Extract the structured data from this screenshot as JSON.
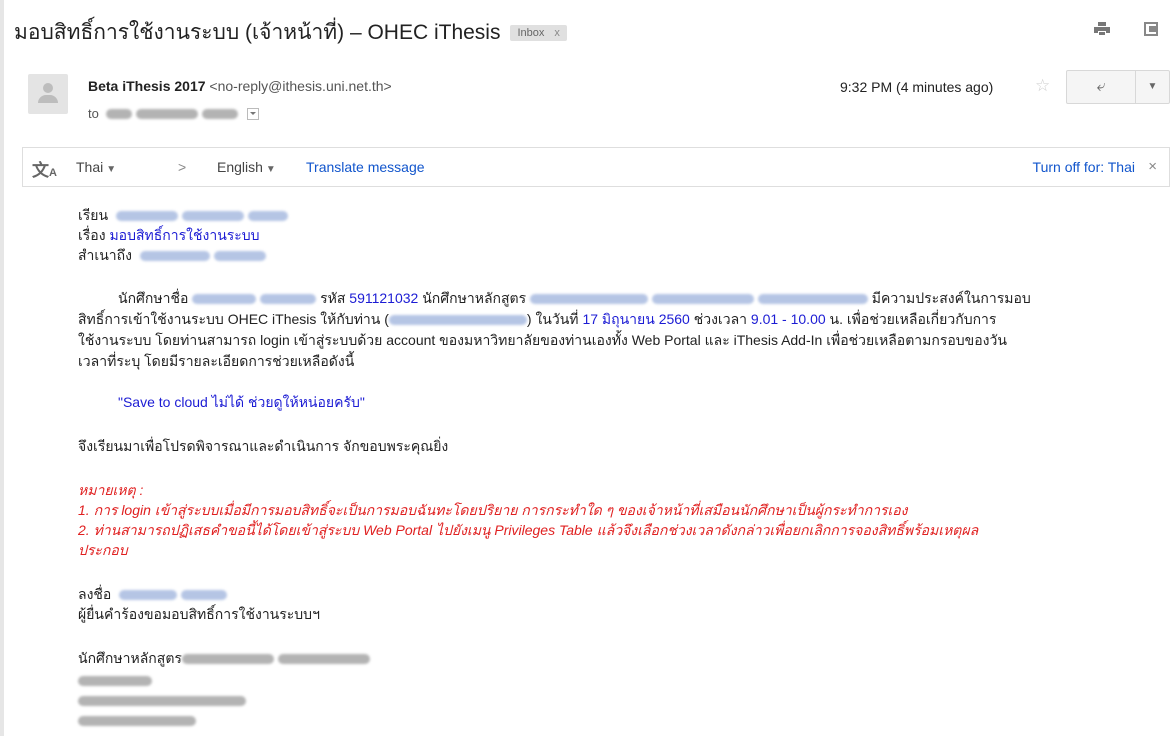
{
  "email": {
    "subject": "มอบสิทธิ์การใช้งานระบบ (เจ้าหน้าที่) – OHEC iThesis",
    "label_chip": "Inbox",
    "label_chip_close": "x",
    "sender_name": "Beta iThesis 2017",
    "sender_email": "<no-reply@ithesis.uni.net.th>",
    "to_prefix": "to",
    "timestamp": "9:32 PM (4 minutes ago)"
  },
  "translate": {
    "from_lang": "Thai",
    "arrow": ">",
    "to_lang": "English",
    "translate_link": "Translate message",
    "turn_off": "Turn off for: Thai",
    "close": "×"
  },
  "body": {
    "greeting_label": "เรียน",
    "subject_label": "เรื่อง",
    "subject_value": "มอบสิทธิ์การใช้งานระบบ",
    "cc_label": "สำเนาถึง",
    "p1_a": "นักศึกษาชื่อ",
    "p1_b": "รหัส",
    "student_id": "591121032",
    "p1_c": "นักศึกษาหลักสูตร",
    "p1_d": "มีความประสงค์ในการมอบ",
    "p2_a": "สิทธิ์การเข้าใช้งานระบบ OHEC iThesis ให้กับท่าน (",
    "p2_b": ") ในวันที่",
    "date_value": "17 มิถุนายน 2560",
    "p2_c": "ช่วงเวลา",
    "time_value": "9.01 - 10.00",
    "p2_d": "น. เพื่อช่วยเหลือเกี่ยวกับการ",
    "p3": "ใช้งานระบบ โดยท่านสามารถ login เข้าสู่ระบบด้วย account ของมหาวิทยาลัยของท่านเองทั้ง Web Portal และ iThesis Add-In เพื่อช่วยเหลือตามกรอบของวัน",
    "p4": "เวลาที่ระบุ โดยมีรายละเอียดการช่วยเหลือดังนี้",
    "request_quote": "\"Save to cloud ไม่ได้ ช่วยดูให้หน่อยครับ\"",
    "closing": "จึงเรียนมาเพื่อโปรดพิจารณาและดำเนินการ จักขอบพระคุณยิ่ง",
    "note_title": "หมายเหตุ :",
    "note_1": "1. การ login เข้าสู่ระบบเมื่อมีการมอบสิทธิ์จะเป็นการมอบฉันทะโดยปริยาย การกระทำใด ๆ ของเจ้าหน้าที่เสมือนนักศึกษาเป็นผู้กระทำการเอง",
    "note_2a": "2. ท่านสามารถปฏิเสธคำขอนี้ได้โดยเข้าสู่ระบบ Web Portal ไปยังเมนู Privileges Table แล้วจึงเลือกช่วงเวลาดังกล่าวเพื่อยกเลิกการจองสิทธิ์พร้อมเหตุผล",
    "note_2b": "ประกอบ",
    "sign_label": "ลงชื่อ",
    "requester_line": "ผู้ยื่นคำร้องขอมอบสิทธิ์การใช้งานระบบฯ",
    "program_label": "นักศึกษาหลักสูตร"
  },
  "colors": {
    "link": "#1155cc",
    "highlight_blue": "#1c1cd4",
    "note_red": "#e02020"
  }
}
